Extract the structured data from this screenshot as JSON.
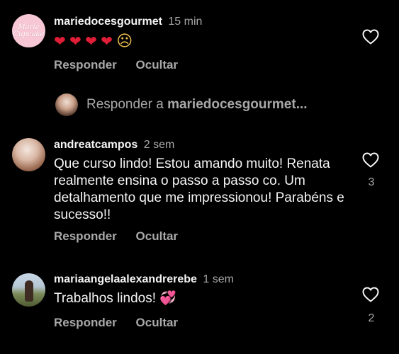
{
  "comments": [
    {
      "username": "mariedocesgourmet",
      "time": "15 min",
      "avatar_text": "Marie Cupcake",
      "text_emojis": [
        "❤",
        "❤",
        "❤",
        "❤",
        "☹"
      ],
      "reply_label": "Responder",
      "hide_label": "Ocultar",
      "likes": ""
    },
    {
      "username": "andreatcampos",
      "time": "2 sem",
      "text": "Que curso lindo! Estou amando muito! Renata realmente ensina o passo a passo co. Um detalhamento que me impressionou! Parabéns e sucesso!!",
      "reply_label": "Responder",
      "hide_label": "Ocultar",
      "likes": "3"
    },
    {
      "username": "mariaangelaalexandrerebe",
      "time": "1 sem",
      "text": "Trabalhos lindos!",
      "emoji": "💞",
      "reply_label": "Responder",
      "hide_label": "Ocultar",
      "likes": "2"
    }
  ],
  "reply_prompt": {
    "prefix": "Responder a",
    "target": "mariedocesgourmet..."
  },
  "colors": {
    "background": "#000000",
    "primary_text": "#f5f5f5",
    "secondary_text": "#a8a8a8",
    "heart_red": "#e01e37"
  },
  "icons": [
    "heart-outline-icon",
    "frowning-face-emoji",
    "red-heart-emoji",
    "revolving-hearts-emoji"
  ]
}
